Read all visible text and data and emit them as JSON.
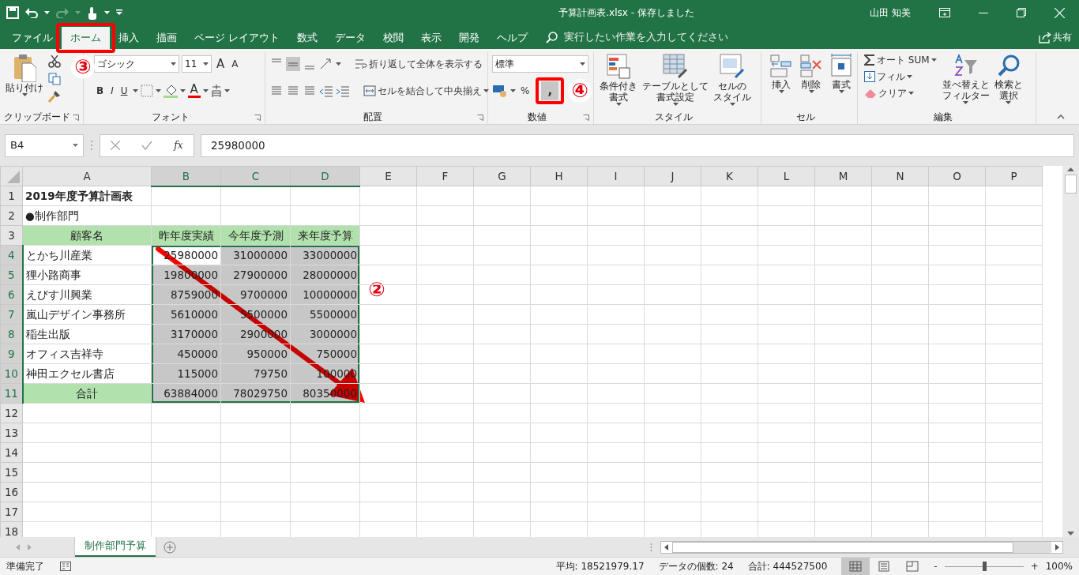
{
  "window": {
    "title": "予算計画表.xlsx  -  保存しました",
    "user": "山田 知美"
  },
  "menu_tabs": [
    {
      "label": "ファイル",
      "selected": false
    },
    {
      "label": "ホーム",
      "selected": true
    },
    {
      "label": "挿入",
      "selected": false
    },
    {
      "label": "描画",
      "selected": false
    },
    {
      "label": "ページ レイアウト",
      "selected": false
    },
    {
      "label": "数式",
      "selected": false
    },
    {
      "label": "データ",
      "selected": false
    },
    {
      "label": "校閲",
      "selected": false
    },
    {
      "label": "表示",
      "selected": false
    },
    {
      "label": "開発",
      "selected": false
    },
    {
      "label": "ヘルプ",
      "selected": false
    }
  ],
  "tell_me": {
    "placeholder": "実行したい作業を入力してください"
  },
  "share": "共有",
  "ribbon": {
    "clipboard": {
      "paste": "貼り付け",
      "label": "クリップボード"
    },
    "font": {
      "font_name": "ゴシック",
      "font_size": "11",
      "grow": "A",
      "shrink": "A",
      "bold": "B",
      "italic": "I",
      "underline": "U",
      "font_color_button": "A",
      "label": "フォント"
    },
    "alignment": {
      "wrap": "折り返して全体を表示する",
      "merge": "セルを結合して中央揃え",
      "label": "配置"
    },
    "number": {
      "format": "標準",
      "percent": "%",
      "comma": ",",
      "label": "数値"
    },
    "styles": {
      "buttons": [
        [
          "条件付き",
          "書式"
        ],
        [
          "テーブルとして",
          "書式設定"
        ],
        [
          "セルの",
          "スタイル"
        ]
      ],
      "label": "スタイル"
    },
    "cells": {
      "buttons": [
        "挿入",
        "削除",
        "書式"
      ],
      "label": "セル"
    },
    "editing": {
      "autosum": "オート SUM",
      "fill": "フィル",
      "clear": "クリア",
      "sort": [
        "並べ替えと",
        "フィルター"
      ],
      "find": [
        "検索と",
        "選択"
      ],
      "label": "編集"
    }
  },
  "formula_bar": {
    "name_box": "B4",
    "function_label": "fx",
    "formula": "25980000"
  },
  "columns": [
    {
      "label": "A",
      "selected": false
    },
    {
      "label": "B",
      "selected": true
    },
    {
      "label": "C",
      "selected": true
    },
    {
      "label": "D",
      "selected": true
    },
    {
      "label": "E",
      "selected": false
    },
    {
      "label": "F",
      "selected": false
    },
    {
      "label": "G",
      "selected": false
    },
    {
      "label": "H",
      "selected": false
    },
    {
      "label": "I",
      "selected": false
    },
    {
      "label": "J",
      "selected": false
    },
    {
      "label": "K",
      "selected": false
    },
    {
      "label": "L",
      "selected": false
    },
    {
      "label": "M",
      "selected": false
    },
    {
      "label": "N",
      "selected": false
    },
    {
      "label": "O",
      "selected": false
    },
    {
      "label": "P",
      "selected": false
    }
  ],
  "rows": [
    {
      "number": "1",
      "kind": "title",
      "selected": false,
      "cells": [
        {
          "text": "2019年度予算計画表",
          "selected": false
        },
        {
          "selected": false
        },
        {
          "selected": false
        },
        {
          "selected": false
        }
      ]
    },
    {
      "number": "2",
      "kind": "section",
      "selected": false,
      "cells": [
        {
          "text": "●制作部門",
          "selected": false
        },
        {
          "selected": false
        },
        {
          "selected": false
        },
        {
          "selected": false
        }
      ]
    },
    {
      "number": "3",
      "kind": "header",
      "selected": false,
      "cells": [
        {
          "text": "顧客名",
          "selected": false
        },
        {
          "text": "昨年度実績",
          "selected": false
        },
        {
          "text": "今年度予測",
          "selected": false
        },
        {
          "text": "来年度予算",
          "selected": false
        }
      ]
    },
    {
      "number": "4",
      "kind": "data",
      "selected": true,
      "cells": [
        {
          "text": "とかち川産業",
          "selected": false
        },
        {
          "text": "25980000",
          "selected": true,
          "active": true
        },
        {
          "text": "31000000",
          "selected": true,
          "active": false
        },
        {
          "text": "33000000",
          "selected": true,
          "active": false
        }
      ]
    },
    {
      "number": "5",
      "kind": "data",
      "selected": true,
      "cells": [
        {
          "text": "狸小路商事",
          "selected": false
        },
        {
          "text": "19800000",
          "selected": true,
          "active": false
        },
        {
          "text": "27900000",
          "selected": true,
          "active": false
        },
        {
          "text": "28000000",
          "selected": true,
          "active": false
        }
      ]
    },
    {
      "number": "6",
      "kind": "data",
      "selected": true,
      "cells": [
        {
          "text": "えびす川興業",
          "selected": false
        },
        {
          "text": "8759000",
          "selected": true,
          "active": false
        },
        {
          "text": "9700000",
          "selected": true,
          "active": false
        },
        {
          "text": "10000000",
          "selected": true,
          "active": false
        }
      ]
    },
    {
      "number": "7",
      "kind": "data",
      "selected": true,
      "cells": [
        {
          "text": "嵐山デザイン事務所",
          "selected": false
        },
        {
          "text": "5610000",
          "selected": true,
          "active": false
        },
        {
          "text": "5500000",
          "selected": true,
          "active": false
        },
        {
          "text": "5500000",
          "selected": true,
          "active": false
        }
      ]
    },
    {
      "number": "8",
      "kind": "data",
      "selected": true,
      "cells": [
        {
          "text": "稲生出版",
          "selected": false
        },
        {
          "text": "3170000",
          "selected": true,
          "active": false
        },
        {
          "text": "2900000",
          "selected": true,
          "active": false
        },
        {
          "text": "3000000",
          "selected": true,
          "active": false
        }
      ]
    },
    {
      "number": "9",
      "kind": "data",
      "selected": true,
      "cells": [
        {
          "text": "オフィス吉祥寺",
          "selected": false
        },
        {
          "text": "450000",
          "selected": true,
          "active": false
        },
        {
          "text": "950000",
          "selected": true,
          "active": false
        },
        {
          "text": "750000",
          "selected": true,
          "active": false
        }
      ]
    },
    {
      "number": "10",
      "kind": "data",
      "selected": true,
      "cells": [
        {
          "text": "神田エクセル書店",
          "selected": false
        },
        {
          "text": "115000",
          "selected": true,
          "active": false
        },
        {
          "text": "79750",
          "selected": true,
          "active": false
        },
        {
          "text": "100000",
          "selected": true,
          "active": false
        }
      ]
    },
    {
      "number": "11",
      "kind": "total",
      "selected": true,
      "cells": [
        {
          "text": "合計",
          "selected": false
        },
        {
          "text": "63884000",
          "selected": true,
          "active": false
        },
        {
          "text": "78029750",
          "selected": true,
          "active": false
        },
        {
          "text": "80350000",
          "selected": true,
          "active": false
        }
      ]
    },
    {
      "number": "12",
      "selected": false
    },
    {
      "number": "13",
      "selected": false
    },
    {
      "number": "14",
      "selected": false
    },
    {
      "number": "15",
      "selected": false
    },
    {
      "number": "16",
      "selected": false
    },
    {
      "number": "17",
      "selected": false
    },
    {
      "number": "18",
      "selected": false
    }
  ],
  "callouts": [
    {
      "label": "③"
    },
    {
      "label": "④"
    },
    {
      "label": "②"
    }
  ],
  "sheet_tabs": [
    {
      "label": "制作部門予算",
      "selected": true
    }
  ],
  "status_bar": {
    "mode": "準備完了",
    "average": "平均: 18521979.17",
    "count": "データの個数: 24",
    "sum": "合計: 444527500",
    "views": [
      {
        "selected": true
      },
      {
        "selected": false
      },
      {
        "selected": false
      }
    ],
    "zoom_out": "-",
    "zoom_in": "+",
    "zoom": {
      "level": 0.5
    },
    "zoom_text": "100%"
  }
}
